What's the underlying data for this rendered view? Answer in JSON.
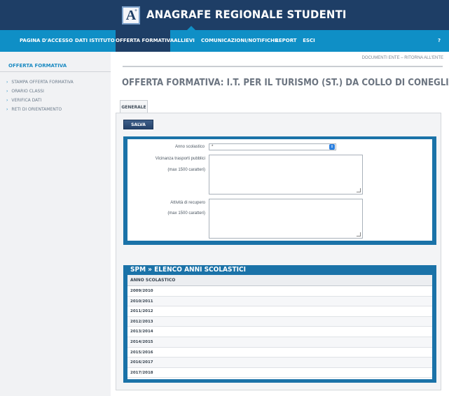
{
  "header": {
    "logo_letter": "A",
    "logo_sup": "+",
    "app_title": "ANAGRAFE REGIONALE STUDENTI"
  },
  "nav": {
    "items": [
      {
        "label": "PAGINA D'ACCESSO"
      },
      {
        "label": "DATI ISTITUTO"
      },
      {
        "label": "OFFERTA FORMATIVA"
      },
      {
        "label": "ALLIEVI"
      },
      {
        "label": "COMUNICAZIONI/NOTIFICHE"
      },
      {
        "label": "REPORT"
      },
      {
        "label": "ESCI"
      }
    ],
    "help": "?"
  },
  "sidebar": {
    "title": "OFFERTA FORMATIVA",
    "items": [
      {
        "label": "STAMPA OFFERTA FORMATIVA"
      },
      {
        "label": "ORARIO CLASSI"
      },
      {
        "label": "VERIFICA DATI"
      },
      {
        "label": "RETI DI ORIENTAMENTO"
      }
    ]
  },
  "top_links": {
    "documenti": "DOCUMENTI ENTE",
    "sep": " – ",
    "ritorna": "RITORNA ALL'ENTE"
  },
  "page_title": "OFFERTA FORMATIVA: I.T. PER IL TURISMO (ST.) DA COLLO DI CONEGLIANO",
  "tab": "GENERALE",
  "save_label": "SALVA",
  "form": {
    "anno_label": "Anno scolastico",
    "anno_value": "*",
    "vicinanza_label": "Vicinanza trasporti pubblici",
    "vicinanza_hint": "(max 1500 caratteri)",
    "attivita_label": "Attività di recupero",
    "attivita_hint": "(max 1500 caratteri)"
  },
  "list": {
    "title": "SPM » ELENCO ANNI SCOLASTICI",
    "header": "ANNO SCOLASTICO",
    "rows": [
      "2009/2010",
      "2010/2011",
      "2011/2012",
      "2012/2013",
      "2013/2014",
      "2014/2015",
      "2015/2016",
      "2016/2017",
      "2017/2018"
    ]
  },
  "colors": {
    "header_bg": "#1e3e66",
    "nav_bg": "#0f8fc6",
    "accent": "#1a72a8"
  }
}
